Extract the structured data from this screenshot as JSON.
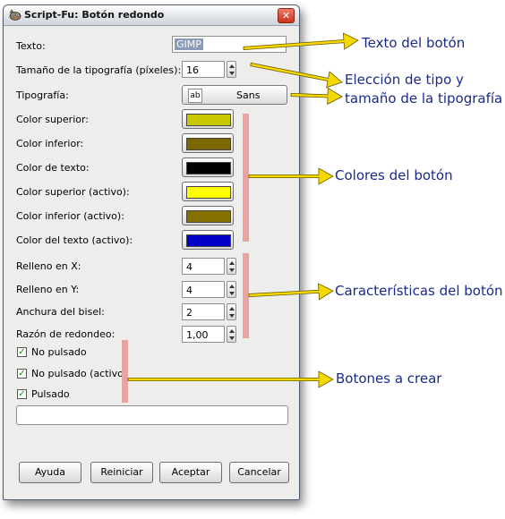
{
  "window": {
    "title": "Script-Fu: Botón redondo",
    "close_glyph": "✕"
  },
  "fields": {
    "texto_label": "Texto:",
    "texto_value": "GIMP",
    "tamano_label": "Tamaño de la tipografía (píxeles):",
    "tamano_value": "16",
    "tipografia_label": "Tipografía:",
    "tipografia_value": "Sans",
    "tipografia_icon_text": "ab"
  },
  "colors": [
    {
      "label": "Color superior:",
      "color": "#c8c800"
    },
    {
      "label": "Color inferior:",
      "color": "#7c6600"
    },
    {
      "label": "Color de texto:",
      "color": "#000000"
    },
    {
      "label": "Color superior (activo):",
      "color": "#ffff00"
    },
    {
      "label": "Color inferior (activo):",
      "color": "#857000"
    },
    {
      "label": "Color del texto (activo):",
      "color": "#0000c8"
    }
  ],
  "spins": [
    {
      "label": "Relleno en X:",
      "value": "4"
    },
    {
      "label": "Relleno en Y:",
      "value": "4"
    },
    {
      "label": "Anchura del bisel:",
      "value": "2"
    },
    {
      "label": "Razón de redondeo:",
      "value": "1,00"
    }
  ],
  "checks": [
    {
      "label": "No pulsado",
      "checked": true
    },
    {
      "label": "No pulsado (activo)",
      "checked": true
    },
    {
      "label": "Pulsado",
      "checked": true
    }
  ],
  "buttons": {
    "help": "Ayuda",
    "reset": "Reiniciar",
    "ok": "Aceptar",
    "cancel": "Cancelar"
  },
  "annotations": {
    "texto": "Texto del botón",
    "tipo_line1": "Elección de tipo y",
    "tipo_line2": "tamaño de la tipografía",
    "colores": "Colores del botón",
    "caracteristicas": "Características del botón",
    "botones": "Botones a crear",
    "arrow_color": "#f5d800",
    "annotation_color": "#1a2a8c"
  }
}
